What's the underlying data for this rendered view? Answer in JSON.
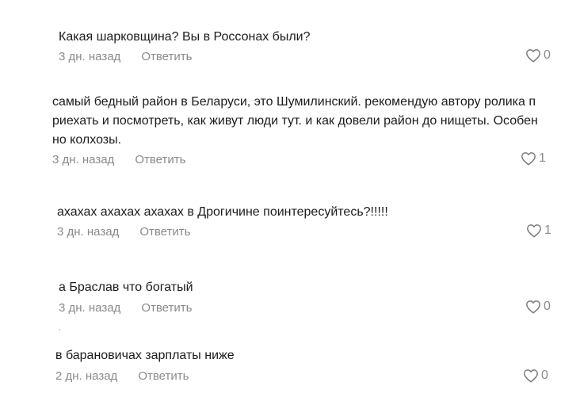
{
  "comments": [
    {
      "text": "Какая шарковщина? Вы в Россонах были?",
      "time": "3 дн. назад",
      "reply_label": "Ответить",
      "likes": "0"
    },
    {
      "text": "самый бедный район в Беларуси, это Шумилинский. рекомендую автору ролика п\nриехать и посмотреть, как живут люди тут. и как довели район до нищеты. Особен\nно колхозы.",
      "time": "3 дн. назад",
      "reply_label": "Ответить",
      "likes": "1"
    },
    {
      "text": "ахахах ахахах ахахах в Дрогичине поинтересуйтесь?!!!!!",
      "time": "3 дн. назад",
      "reply_label": "Ответить",
      "likes": "1"
    },
    {
      "text": "а Браслав что богатый",
      "time": "3 дн. назад",
      "reply_label": "Ответить",
      "likes": "0"
    },
    {
      "text": "в барановичах зарплаты ниже",
      "time": "2 дн. назад",
      "reply_label": "Ответить",
      "likes": "0"
    }
  ],
  "icons": {
    "like": "heart-outline-icon"
  },
  "colors": {
    "text": "#1c1c1c",
    "muted": "#8a8a8a"
  }
}
